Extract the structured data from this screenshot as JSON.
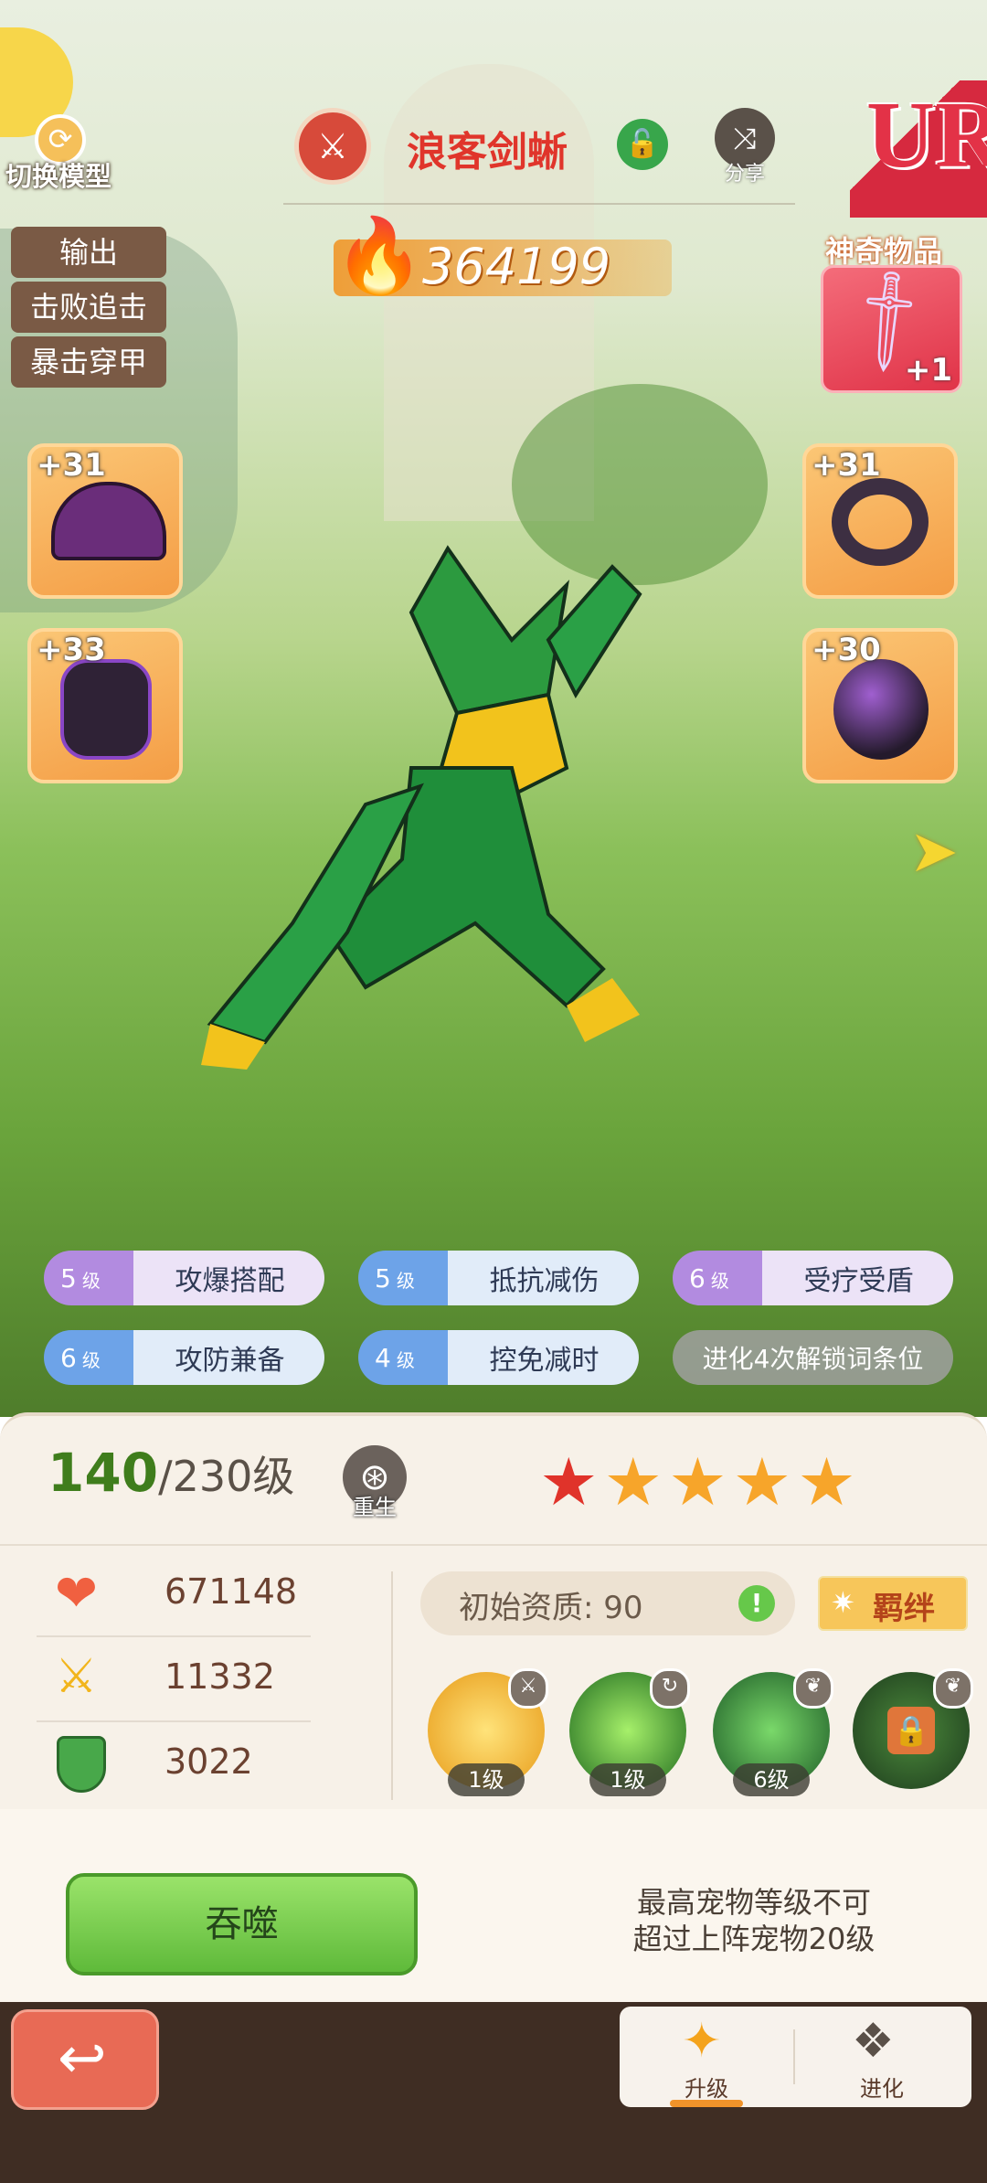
{
  "header": {
    "switch_model_label": "切换模型",
    "pet_name": "浪客剑蜥",
    "share_label": "分享",
    "rarity": "UR",
    "power": "364199"
  },
  "left_tags": [
    "输出",
    "击败追击",
    "暴击穿甲"
  ],
  "artifact": {
    "label": "神奇物品",
    "level": "+1"
  },
  "equipment": {
    "top_left": "+31",
    "bottom_left": "+33",
    "top_right": "+31",
    "bottom_right": "+30"
  },
  "traits": [
    {
      "level": "5",
      "unit": "级",
      "name": "攻爆搭配",
      "color": "purple"
    },
    {
      "level": "5",
      "unit": "级",
      "name": "抵抗减伤",
      "color": "blue"
    },
    {
      "level": "6",
      "unit": "级",
      "name": "受疗受盾",
      "color": "purple"
    },
    {
      "level": "6",
      "unit": "级",
      "name": "攻防兼备",
      "color": "blue"
    },
    {
      "level": "4",
      "unit": "级",
      "name": "控免减时",
      "color": "blue"
    }
  ],
  "locked_trait": "进化4次解锁词条位",
  "level": {
    "current": "140",
    "max": "/230级",
    "rebirth_label": "重生",
    "stars": 5
  },
  "stats": {
    "hp": "671148",
    "attack": "11332",
    "defense": "3022"
  },
  "aptitude": "初始资质: 90",
  "bond_label": "羁绊",
  "skills": [
    {
      "level": "1级",
      "icon": "sword-tag-icon"
    },
    {
      "level": "1级",
      "icon": "swirl-tag-icon"
    },
    {
      "level": "6级",
      "icon": "leaf-tag-icon"
    },
    {
      "level": "",
      "icon": "lock-icon"
    }
  ],
  "devour_label": "吞噬",
  "notice": {
    "line1": "最高宠物等级不可",
    "line2": "超过上阵宠物20级"
  },
  "bottom_tabs": [
    {
      "label": "升级",
      "active": true
    },
    {
      "label": "进化",
      "active": false
    }
  ],
  "colors": {
    "accent_green": "#3f7d1c",
    "rarity_red": "#d6293f",
    "button_green": "#79cf4d"
  }
}
